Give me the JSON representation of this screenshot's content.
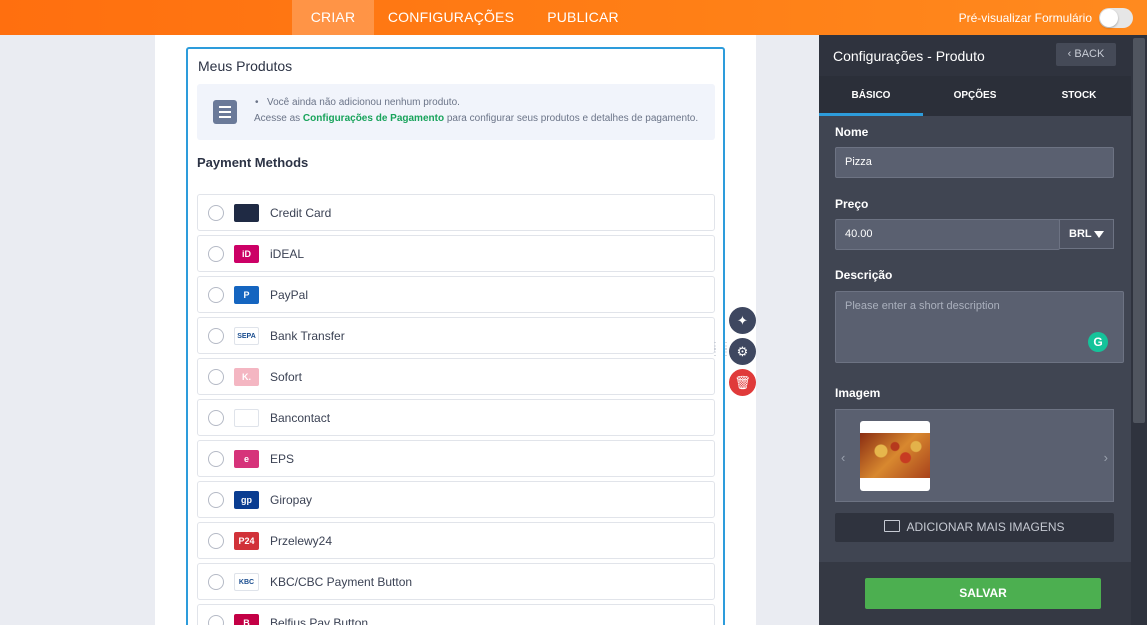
{
  "topbar": {
    "tabs": [
      "CRIAR",
      "CONFIGURAÇÕES",
      "PUBLICAR"
    ],
    "preview_label": "Pré-visualizar Formulário"
  },
  "form": {
    "field_title": "Meus Produtos",
    "notice_bullet": "•",
    "notice_line1": "Você ainda não adicionou nenhum produto.",
    "notice_line2_prefix": "Acesse as",
    "notice_line2_link": "Configurações de Pagamento",
    "notice_line2_suffix": "para configurar seus produtos e detalhes de pagamento.",
    "payment_heading": "Payment Methods",
    "payment_methods": [
      {
        "label": "Credit Card",
        "logo": "",
        "color": "#1f2a44"
      },
      {
        "label": "iDEAL",
        "logo": "iD",
        "color": "#cc0066"
      },
      {
        "label": "PayPal",
        "logo": "P",
        "color": "#1565c0"
      },
      {
        "label": "Bank Transfer",
        "logo": "SEPA",
        "color": "#ffffff"
      },
      {
        "label": "Sofort",
        "logo": "K.",
        "color": "#f4b6c2"
      },
      {
        "label": "Bancontact",
        "logo": "",
        "color": "#ffffff"
      },
      {
        "label": "EPS",
        "logo": "e",
        "color": "#d6337a"
      },
      {
        "label": "Giropay",
        "logo": "gp",
        "color": "#0a3d91"
      },
      {
        "label": "Przelewy24",
        "logo": "P24",
        "color": "#d13239"
      },
      {
        "label": "KBC/CBC Payment Button",
        "logo": "KBC",
        "color": "#ffffff"
      },
      {
        "label": "Belfius Pay Button",
        "logo": "B",
        "color": "#c30045"
      }
    ]
  },
  "tools": {
    "wand": "✦",
    "gear": "⚙",
    "trash": "🗑"
  },
  "panel": {
    "title": "Configurações - Produto",
    "back_label": "‹ BACK",
    "tabs": [
      "BÁSICO",
      "OPÇÕES",
      "STOCK"
    ],
    "name_label": "Nome",
    "name_value": "Pizza",
    "price_label": "Preço",
    "price_value": "40.00",
    "currency": "BRL",
    "description_label": "Descrição",
    "description_placeholder": "Please enter a short description",
    "image_label": "Imagem",
    "add_images_label": "ADICIONAR MAIS IMAGENS",
    "save_label": "SALVAR"
  },
  "colors": {
    "accent": "#ff7f16",
    "link": "#18a35b",
    "save": "#4caf50",
    "selected_border": "#2d9cdb"
  }
}
